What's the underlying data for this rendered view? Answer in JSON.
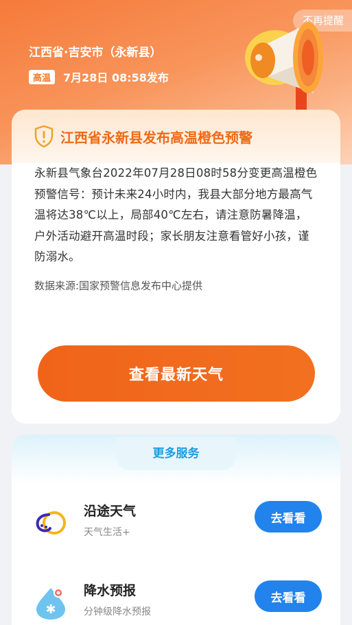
{
  "header": {
    "dismiss_label": "不再提醒",
    "location": "江西省·吉安市（永新县）",
    "level_badge": "高温",
    "publish_time": "7月28日  08:58发布"
  },
  "alert": {
    "title": "江西省永新县发布高温橙色预警",
    "body": "永新县气象台2022年07月28日08时58分变更高温橙色预警信号：预计未来24小时内，我县大部分地方最高气温将达38℃以上，局部40℃左右，请注意防暑降温，户外活动避开高温时段；家长朋友注意看管好小孩，谨防溺水。",
    "source": "数据来源:国家预警信息发布中心提供",
    "cta_label": "查看最新天气"
  },
  "services": {
    "title": "更多服务",
    "items": [
      {
        "name": "沿途天气",
        "desc": "天气生活+",
        "button": "去看看",
        "icon": "route-weather-icon"
      },
      {
        "name": "降水预报",
        "desc": "分钟级降水预报",
        "button": "去看看",
        "icon": "rain-forecast-icon"
      }
    ]
  },
  "colors": {
    "accent_orange": "#f0641a",
    "alert_title": "#ee6a16",
    "service_blue": "#2283ec",
    "services_title": "#1a9ee2"
  }
}
